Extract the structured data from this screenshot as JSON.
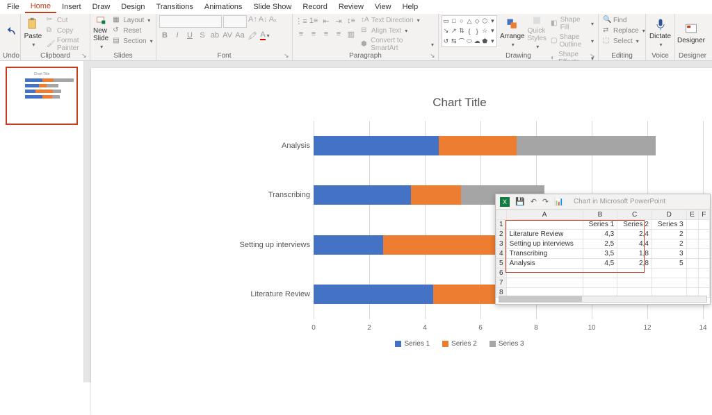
{
  "menu": {
    "file": "File",
    "home": "Home",
    "insert": "Insert",
    "draw": "Draw",
    "design": "Design",
    "transitions": "Transitions",
    "animations": "Animations",
    "slideshow": "Slide Show",
    "record": "Record",
    "review": "Review",
    "view": "View",
    "help": "Help"
  },
  "ribbon": {
    "undo_label": "Undo",
    "clipboard": {
      "paste": "Paste",
      "cut": "Cut",
      "copy": "Copy",
      "format_painter": "Format Painter",
      "label": "Clipboard"
    },
    "slides": {
      "new_slide": "New\nSlide",
      "layout": "Layout",
      "reset": "Reset",
      "section": "Section",
      "label": "Slides"
    },
    "font": {
      "label": "Font"
    },
    "paragraph": {
      "label": "Paragraph",
      "text_direction": "Text Direction",
      "align_text": "Align Text",
      "convert_smartart": "Convert to SmartArt"
    },
    "drawing": {
      "label": "Drawing",
      "arrange": "Arrange",
      "quick_styles": "Quick\nStyles",
      "shape_fill": "Shape Fill",
      "shape_outline": "Shape Outline",
      "shape_effects": "Shape Effects"
    },
    "editing": {
      "label": "Editing",
      "find": "Find",
      "replace": "Replace",
      "select": "Select"
    },
    "voice": {
      "label": "Voice",
      "dictate": "Dictate"
    },
    "designer": {
      "label": "Designer",
      "btn": "Designer"
    }
  },
  "chart_data": {
    "type": "bar",
    "orientation": "horizontal",
    "stacked": true,
    "title": "Chart Title",
    "categories": [
      "Analysis",
      "Transcribing",
      "Setting up interviews",
      "Literature Review"
    ],
    "series": [
      {
        "name": "Series 1",
        "values": [
          4.5,
          3.5,
          2.5,
          4.3
        ],
        "color": "#4472c4"
      },
      {
        "name": "Series 2",
        "values": [
          2.8,
          1.8,
          4.4,
          2.4
        ],
        "color": "#ed7d31"
      },
      {
        "name": "Series 3",
        "values": [
          5,
          3,
          2,
          2
        ],
        "color": "#a5a5a5"
      }
    ],
    "x_ticks": [
      0,
      2,
      4,
      6,
      8,
      10,
      12,
      14
    ],
    "xlim": [
      0,
      14
    ],
    "legend_position": "bottom"
  },
  "data_window": {
    "title": "Chart in Microsoft PowerPoint",
    "columns": [
      "A",
      "B",
      "C",
      "D",
      "E",
      "F"
    ],
    "headers": {
      "B": "Series 1",
      "C": "Series 2",
      "D": "Series 3"
    },
    "rows": [
      {
        "n": 1,
        "A": "",
        "B": "Series 1",
        "C": "Series 2",
        "D": "Series 3"
      },
      {
        "n": 2,
        "A": "Literature Review",
        "B": "4,3",
        "C": "2,4",
        "D": "2"
      },
      {
        "n": 3,
        "A": "Setting up interviews",
        "B": "2,5",
        "C": "4,4",
        "D": "2"
      },
      {
        "n": 4,
        "A": "Transcribing",
        "B": "3,5",
        "C": "1,8",
        "D": "3"
      },
      {
        "n": 5,
        "A": "Analysis",
        "B": "4,5",
        "C": "2,8",
        "D": "5"
      },
      {
        "n": 6,
        "A": "",
        "B": "",
        "C": "",
        "D": ""
      },
      {
        "n": 7,
        "A": "",
        "B": "",
        "C": "",
        "D": ""
      },
      {
        "n": 8,
        "A": "",
        "B": "",
        "C": "",
        "D": ""
      }
    ]
  }
}
